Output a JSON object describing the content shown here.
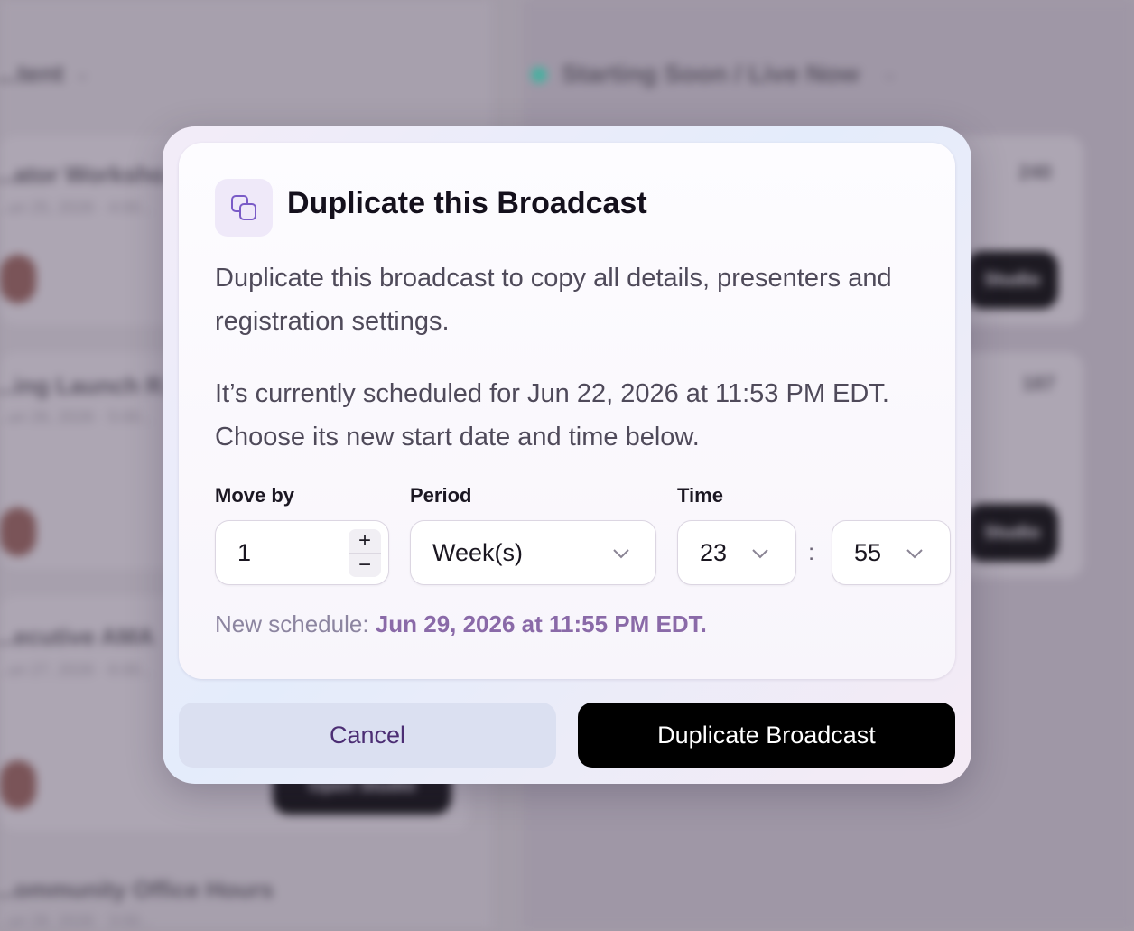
{
  "background": {
    "left_header": "...tent",
    "right_header": "Starting Soon / Live Now",
    "left_items": [
      {
        "title": "...ator Worksho...",
        "sub": "...un 25, 2026 · 4:00..."
      },
      {
        "title": "...ing Launch R...",
        "sub": "...un 26, 2026 · 5:00..."
      },
      {
        "title": "...ecutive AMA",
        "sub": "...un 27, 2026 · 6:00..."
      },
      {
        "title": "...ommunity Office Hours",
        "sub": "...un 28, 2026 · 3:00..."
      }
    ],
    "right_items": [
      {
        "stat": "240"
      },
      {
        "stat": "187"
      }
    ],
    "button_label": "Studio",
    "left_button_label": "Open Studio"
  },
  "dialog": {
    "icon": "duplicate-icon",
    "title": "Duplicate this Broadcast",
    "description": "Duplicate this broadcast to copy all details, presenters and registration settings.",
    "schedule_text": "It’s currently scheduled for Jun 22, 2026 at 11:53 PM EDT. Choose its new start date and time below.",
    "move_by": {
      "label": "Move by",
      "value": "1",
      "plus": "+",
      "minus": "−"
    },
    "period": {
      "label": "Period",
      "value": "Week(s)"
    },
    "time": {
      "label": "Time",
      "hour": "23",
      "separator": ":",
      "minute": "55"
    },
    "new_schedule": {
      "prefix": "New schedule:",
      "value": "Jun 29, 2026 at 11:55 PM EDT."
    },
    "cancel_label": "Cancel",
    "confirm_label": "Duplicate Broadcast"
  },
  "colors": {
    "accent": "#8a6aa8",
    "primary_button": "#000000",
    "cancel_text": "#4c2e74"
  }
}
